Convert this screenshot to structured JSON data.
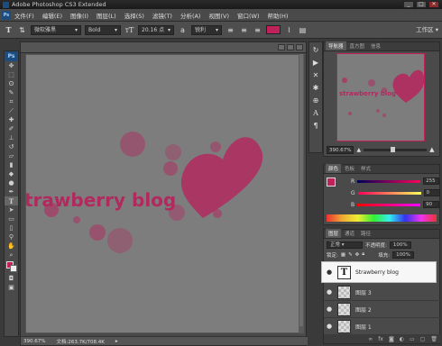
{
  "app": {
    "title": "Adobe Photoshop CS3 Extended",
    "logo": "Ps"
  },
  "menu": [
    "文件(F)",
    "编辑(E)",
    "图像(I)",
    "图层(L)",
    "选择(S)",
    "滤镜(T)",
    "分析(A)",
    "视图(V)",
    "窗口(W)",
    "帮助(H)"
  ],
  "options_bar": {
    "font_family": "微软雅黑",
    "font_style": "Bold",
    "font_size": "20.16 点",
    "aa_label": "a",
    "antialias": "锐利",
    "text_color": "#c0215a",
    "workspace": "工作区"
  },
  "document": {
    "canvas_text": "trawberry blog",
    "zoom": "390.67%",
    "doc_info": "文档:263.7K/708.4K",
    "accent": "#b2295e"
  },
  "navigator": {
    "tabs": [
      "导航器",
      "直方图",
      "信息"
    ],
    "zoom": "390.67%",
    "thumb_text": "strawberry blog"
  },
  "color_panel": {
    "tabs": [
      "颜色",
      "色板",
      "样式"
    ],
    "channels": [
      {
        "label": "R",
        "value": "255"
      },
      {
        "label": "G",
        "value": "0"
      },
      {
        "label": "B",
        "value": "90"
      }
    ]
  },
  "layers_panel": {
    "tabs": [
      "图层",
      "通道",
      "路径"
    ],
    "blend_mode": "正常",
    "opacity_label": "不透明度:",
    "opacity": "100%",
    "lock_label": "锁定:",
    "fill_label": "填充:",
    "fill": "100%",
    "layers": [
      {
        "name": "Strawberry blog",
        "type": "text",
        "selected": true
      },
      {
        "name": "图层 3",
        "type": "pixel"
      },
      {
        "name": "图层 2",
        "type": "pixel"
      },
      {
        "name": "图层 1",
        "type": "pixel"
      }
    ],
    "footer_icons": [
      "link-icon",
      "fx-icon",
      "mask-icon",
      "adjustment-icon",
      "folder-icon",
      "new-layer-icon",
      "trash-icon"
    ]
  },
  "tools": [
    "move",
    "marquee",
    "lasso",
    "quick-select",
    "crop",
    "slice",
    "healing",
    "brush",
    "stamp",
    "history-brush",
    "eraser",
    "gradient",
    "blur",
    "dodge",
    "pen",
    "type",
    "path-select",
    "shape",
    "notes",
    "eyedropper",
    "hand",
    "zoom"
  ]
}
